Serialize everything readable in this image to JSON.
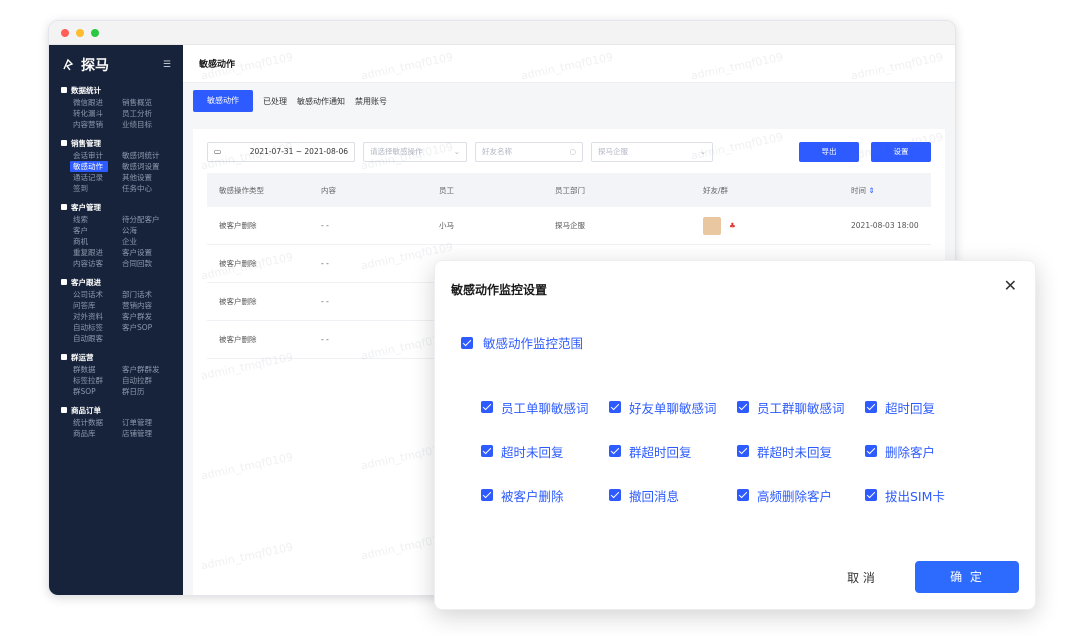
{
  "app": {
    "logo_text": "探马",
    "page_title": "敏感动作"
  },
  "sidebar": {
    "sections": [
      {
        "title": "数据统计",
        "items": [
          "微信跟进",
          "销售概览",
          "转化漏斗",
          "员工分析",
          "内容营销",
          "业绩目标"
        ]
      },
      {
        "title": "销售管理",
        "items": [
          "会话审计",
          "敏感词统计",
          "敏感动作",
          "敏感词设置",
          "通话记录",
          "其他设置",
          "签到",
          "任务中心"
        ]
      },
      {
        "title": "客户管理",
        "items": [
          "线索",
          "待分配客户",
          "客户",
          "公海",
          "商机",
          "企业",
          "重复跟进",
          "客户设置",
          "内容访客",
          "合同回款"
        ]
      },
      {
        "title": "客户跟进",
        "items": [
          "公司话术",
          "部门话术",
          "问答库",
          "营销内容",
          "对外资料",
          "客户群发",
          "自动标签",
          "客户SOP",
          "自动跟客"
        ]
      },
      {
        "title": "群运营",
        "items": [
          "群数据",
          "客户群群发",
          "标签拉群",
          "自动拉群",
          "群SOP",
          "群日历"
        ]
      },
      {
        "title": "商品订单",
        "items": [
          "统计数据",
          "订单管理",
          "商品库",
          "店铺管理"
        ]
      }
    ],
    "active_item": "敏感动作"
  },
  "tabs": [
    {
      "label": "敏感动作",
      "active": true
    },
    {
      "label": "已处理",
      "active": false
    },
    {
      "label": "敏感动作通知",
      "active": false
    },
    {
      "label": "禁用账号",
      "active": false
    }
  ],
  "filters": {
    "date_range": "2021-07-31 ~ 2021-08-06",
    "action_placeholder": "请选择敏感操作",
    "friend_placeholder": "好友名称",
    "company_placeholder": "探马企服",
    "export_label": "导出",
    "settings_label": "设置"
  },
  "table": {
    "headers": [
      "敏感操作类型",
      "内容",
      "员工",
      "员工部门",
      "好友/群",
      "时间"
    ],
    "rows": [
      [
        "被客户删除",
        "- -",
        "小马",
        "探马企服",
        "",
        "2021-08-03 18:00"
      ],
      [
        "被客户删除",
        "- -",
        "",
        "",
        "",
        ""
      ],
      [
        "被客户删除",
        "- -",
        "",
        "",
        "",
        ""
      ],
      [
        "被客户删除",
        "- -",
        "",
        "",
        "",
        ""
      ]
    ]
  },
  "watermark": "admin_tmqf0109",
  "modal": {
    "title": "敏感动作监控设置",
    "close_glyph": "✕",
    "scope_label": "敏感动作监控范围",
    "options": [
      "员工单聊敏感词",
      "好友单聊敏感词",
      "员工群聊敏感词",
      "超时回复",
      "超时未回复",
      "群超时回复",
      "群超时未回复",
      "删除客户",
      "被客户删除",
      "撤回消息",
      "高频删除客户",
      "拔出SIM卡"
    ],
    "cancel_label": "取 消",
    "confirm_label": "确 定"
  },
  "colors": {
    "primary": "#2d5bff",
    "sidebar_bg": "#17233a"
  }
}
